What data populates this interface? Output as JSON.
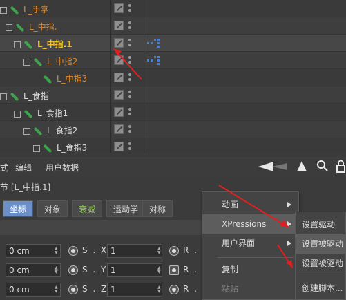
{
  "tree": {
    "nodes": [
      {
        "label": "L_手掌",
        "style": "orange"
      },
      {
        "label": "L_中指.",
        "style": "orange"
      },
      {
        "label": "L_中指.1",
        "style": "selected"
      },
      {
        "label": "L_中指2",
        "style": "orange"
      },
      {
        "label": "L_中指3",
        "style": "orange"
      },
      {
        "label": "L_食指",
        "style": "white"
      },
      {
        "label": "L_食指1",
        "style": "white"
      },
      {
        "label": "L_食指2",
        "style": "white"
      },
      {
        "label": "L_食指3",
        "style": "white"
      }
    ]
  },
  "menubar": {
    "items": [
      "式",
      "编辑",
      "用户数据"
    ]
  },
  "attributes": {
    "path": "节 [L_中指.1]",
    "tabs": [
      "坐标",
      "对象",
      "衰减",
      "运动学",
      "对称"
    ]
  },
  "coords": {
    "rows": [
      {
        "pos_value": "0 cm",
        "scale_label": "S . X",
        "scale_value": "1",
        "rot_label": "R . H"
      },
      {
        "pos_value": "0 cm",
        "scale_label": "S . Y",
        "scale_value": "1",
        "rot_label": "R . P"
      },
      {
        "pos_value": "0 cm",
        "scale_label": "S . Z",
        "scale_value": "1",
        "rot_label": "R . B"
      }
    ]
  },
  "context_menu": {
    "items": [
      "动画",
      "XPressions",
      "用户界面",
      "复制",
      "粘贴"
    ]
  },
  "submenu": {
    "items": [
      "设置驱动",
      "设置被驱动",
      "设置被驱动",
      "创建脚本..."
    ]
  },
  "colors": {
    "accent": "#6a8fc9",
    "selected_label": "#f2c12e",
    "orange_label": "#e08a2a",
    "annotation_arrow": "#e02020"
  }
}
